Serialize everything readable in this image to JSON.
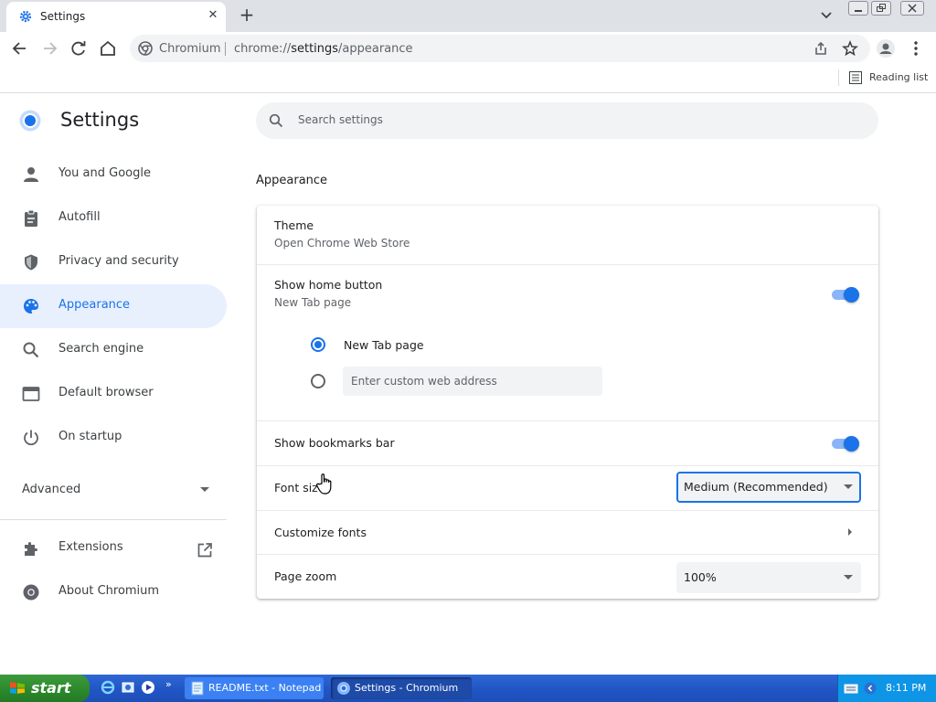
{
  "browser": {
    "tab": {
      "title": "Settings",
      "close_icon": "close-icon"
    },
    "omnibox": {
      "site": "Chromium",
      "url_prefix": "chrome://",
      "url_host": "settings",
      "url_path": "/appearance"
    },
    "bookmarks_bar": {
      "reading_list": "Reading list"
    },
    "colors": {
      "tab_strip": "#dee1e6",
      "accent": "#1a73e8",
      "accent_light": "#e8f0fe"
    }
  },
  "settings": {
    "title": "Settings",
    "search_placeholder": "Search settings",
    "nav": [
      {
        "label": "You and Google",
        "icon": "person-icon"
      },
      {
        "label": "Autofill",
        "icon": "clipboard-icon"
      },
      {
        "label": "Privacy and security",
        "icon": "shield-icon"
      },
      {
        "label": "Appearance",
        "icon": "palette-icon",
        "active": true
      },
      {
        "label": "Search engine",
        "icon": "search-icon"
      },
      {
        "label": "Default browser",
        "icon": "browser-window-icon"
      },
      {
        "label": "On startup",
        "icon": "power-icon"
      }
    ],
    "advanced": "Advanced",
    "extensions": "Extensions",
    "about": "About Chromium",
    "section": "Appearance",
    "rows": {
      "theme": {
        "label": "Theme",
        "sub": "Open Chrome Web Store"
      },
      "home_button": {
        "label": "Show home button",
        "sub": "New Tab page",
        "enabled": true
      },
      "home_options": {
        "new_tab": "New Tab page",
        "custom_placeholder": "Enter custom web address",
        "selected": "new_tab"
      },
      "bookmarks_bar": {
        "label": "Show bookmarks bar",
        "enabled": true
      },
      "font_size": {
        "label": "Font size",
        "value": "Medium (Recommended)"
      },
      "customize_fonts": {
        "label": "Customize fonts"
      },
      "page_zoom": {
        "label": "Page zoom",
        "value": "100%"
      }
    }
  },
  "taskbar": {
    "start": "start",
    "tasks": [
      {
        "label": "README.txt - Notepad",
        "icon": "notepad-icon"
      },
      {
        "label": "Settings - Chromium",
        "icon": "chromium-icon",
        "active": true
      }
    ],
    "clock": "8:11 PM"
  }
}
